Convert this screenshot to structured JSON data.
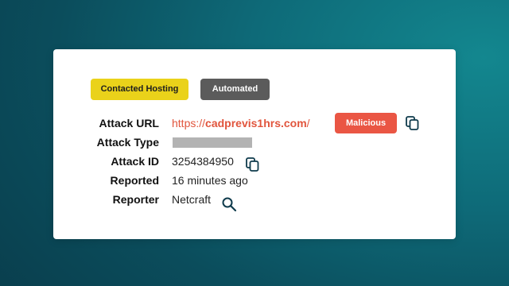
{
  "tags": {
    "hosting": "Contacted Hosting",
    "automated": "Automated"
  },
  "fields": {
    "attack_url": {
      "label": "Attack URL",
      "value_prefix": "https://",
      "value_domain": "cadprevis1hrs.com",
      "value_suffix": "/"
    },
    "attack_type": {
      "label": "Attack Type"
    },
    "attack_id": {
      "label": "Attack ID",
      "value": "3254384950"
    },
    "reported": {
      "label": "Reported",
      "value": "16 minutes ago"
    },
    "reporter": {
      "label": "Reporter",
      "value": "Netcraft"
    }
  },
  "badge": {
    "label": "Malicious"
  },
  "icons": {
    "copy_url": "copy-icon",
    "copy_id": "copy-icon",
    "search_reporter": "search-icon"
  },
  "colors": {
    "hosting_tag": "#ead21a",
    "automated_tag": "#5b5b5b",
    "malicious_badge": "#ea5644",
    "url_text": "#e1553d",
    "icon_stroke": "#0f3b4c"
  }
}
